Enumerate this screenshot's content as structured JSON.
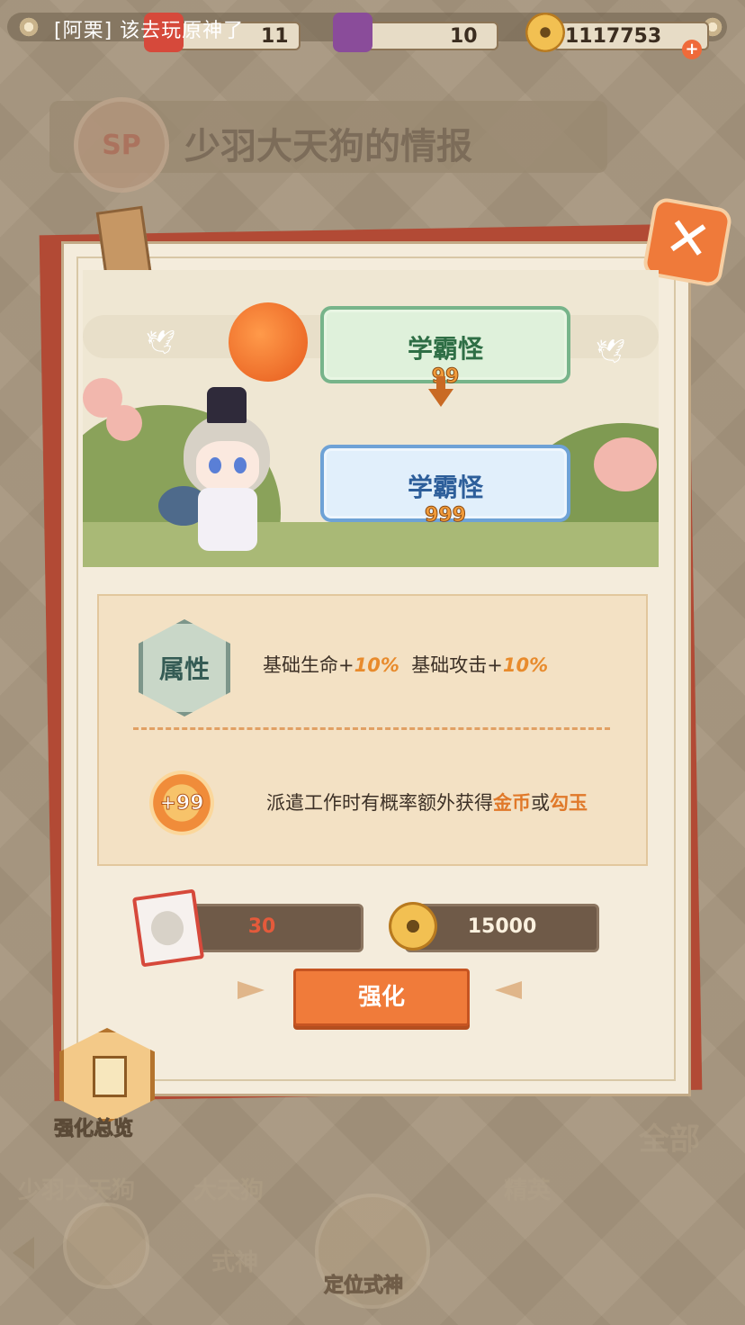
{
  "topbar": {
    "notice": "[阿栗] 该去玩原神了",
    "shard_count": "11",
    "ticket_count": "10",
    "gold_count": "1117753"
  },
  "info": {
    "badge": "SP",
    "title": "少羽大天狗的情报"
  },
  "ranks": {
    "current_label": "学霸怪",
    "current_level": "99",
    "next_label": "学霸怪",
    "next_level": "999"
  },
  "effects": {
    "attr_badge": "属性",
    "attr_hp_label": "基础生命+",
    "attr_hp_value": "10%",
    "attr_atk_label": "基础攻击+",
    "attr_atk_value": "10%",
    "dispatch_prefix": "派遣工作时有概率额外获得",
    "dispatch_gold": "金币",
    "dispatch_or": "或",
    "dispatch_jade": "勾玉"
  },
  "costs": {
    "shard": "30",
    "gold": "15000"
  },
  "buttons": {
    "enhance": "强化",
    "overview": "强化总览",
    "locate": "定位式神"
  },
  "bottom_faded": {
    "tabs": [
      "少羽大天狗",
      "大天狗",
      "精英",
      "式神",
      "全部"
    ]
  },
  "colors": {
    "accent_orange": "#f07b3a",
    "card_red": "#b24a35",
    "highlight": "#e0792a"
  }
}
